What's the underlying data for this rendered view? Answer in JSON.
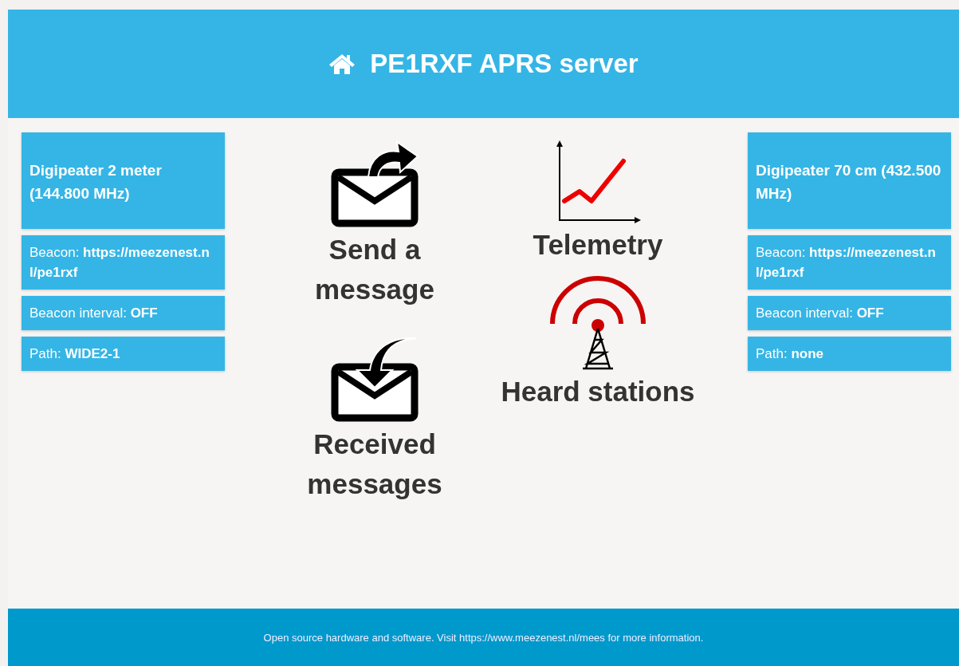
{
  "header": {
    "title": "PE1RXF APRS server"
  },
  "panels": [
    {
      "title": "Digipeater 2 meter (144.800 MHz)",
      "rows": [
        "Beacon: **https://meezenest.nl/pe1rxf**",
        "Beacon interval: **OFF**",
        "Path: **WIDE2-1**"
      ]
    },
    {
      "title": "Digipeater 70 cm (432.500 MHz)",
      "rows": [
        "Beacon: **https://meezenest.nl/pe1rxf**",
        "Beacon interval: **OFF**",
        "Path: **none**"
      ]
    }
  ],
  "tiles": [
    {
      "kind": "send",
      "label": "Send a message"
    },
    {
      "kind": "received",
      "label": "Received messages"
    },
    {
      "kind": "telemetry",
      "label": "Telemetry"
    },
    {
      "kind": "heard",
      "label": "Heard stations"
    }
  ],
  "footer": {
    "text": "Open source hardware and software. Visit https://www.meezenest.nl/mees for more information."
  }
}
